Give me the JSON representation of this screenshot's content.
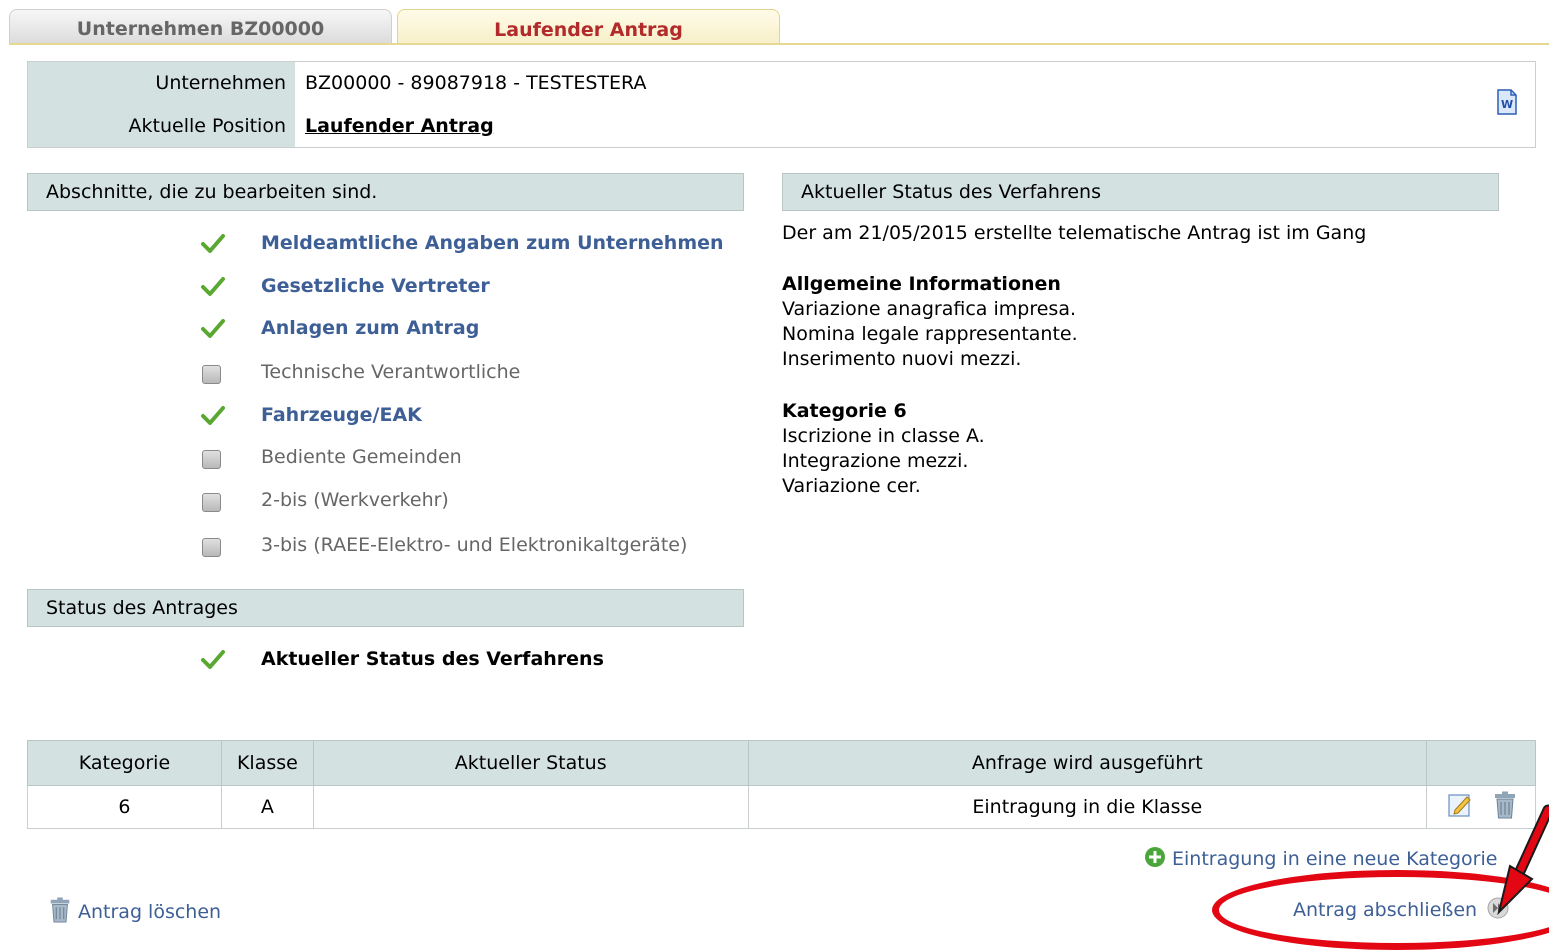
{
  "tabs": [
    {
      "label": "Unternehmen BZ00000"
    },
    {
      "label": "Laufender Antrag"
    }
  ],
  "info": {
    "company_label": "Unternehmen",
    "company_value": "BZ00000 - 89087918 - TESTESTERA",
    "position_label": "Aktuelle Position",
    "position_value": "Laufender Antrag"
  },
  "sections": {
    "heading": "Abschnitte, die zu bearbeiten sind.",
    "items": [
      {
        "label": "Meldeamtliche Angaben zum Unternehmen",
        "done": true
      },
      {
        "label": "Gesetzliche Vertreter",
        "done": true
      },
      {
        "label": "Anlagen zum Antrag",
        "done": true
      },
      {
        "label": "Technische Verantwortliche",
        "done": false
      },
      {
        "label": "Fahrzeuge/EAK",
        "done": true
      },
      {
        "label": "Bediente Gemeinden",
        "done": false
      },
      {
        "label": "2-bis (Werkverkehr)",
        "done": false
      },
      {
        "label": "3-bis (RAEE-Elektro- und Elektronikaltgeräte)",
        "done": false
      }
    ]
  },
  "procedure": {
    "heading": "Aktueller Status des Verfahrens",
    "intro": "Der am 21/05/2015 erstellte telematische Antrag ist im Gang",
    "general_title": "Allgemeine Informationen",
    "general_lines": [
      "Variazione anagrafica impresa.",
      "Nomina legale rappresentante.",
      "Inserimento nuovi mezzi."
    ],
    "category_title": "Kategorie 6",
    "category_lines": [
      "Iscrizione in classe A.",
      "Integrazione mezzi.",
      "Variazione cer."
    ]
  },
  "application_status": {
    "heading": "Status des Antrages",
    "item": "Aktueller Status des Verfahrens"
  },
  "table": {
    "headers": [
      "Kategorie",
      "Klasse",
      "Aktueller Status",
      "Anfrage wird ausgeführt",
      ""
    ],
    "rows": [
      {
        "kategorie": "6",
        "klasse": "A",
        "status": "",
        "anfrage": "Eintragung in die Klasse"
      }
    ]
  },
  "footer": {
    "new_category": "Eintragung in eine neue Kategorie",
    "delete": "Antrag löschen",
    "complete": "Antrag abschließen"
  },
  "colors": {
    "header_bg": "#d3e2e1",
    "link": "#3d5f96",
    "active_tab_text": "#b22a2a",
    "check_green": "#5aa832",
    "highlight_red": "#e30613"
  }
}
